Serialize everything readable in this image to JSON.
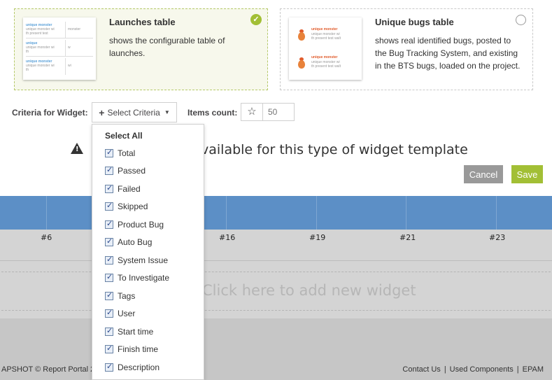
{
  "cards": [
    {
      "title": "Launches table",
      "description": "shows the configurable table of launches.",
      "selected": true,
      "thumb_rows": [
        {
          "line1": "unique monster",
          "line2": "unique monster wi",
          "line3": "th present test",
          "side": "monster"
        },
        {
          "line1": "unique",
          "line2": "unique monster wi",
          "line3": "th",
          "side": "w"
        },
        {
          "line1": "unique monster",
          "line2": "unique monster wi",
          "line3": "th",
          "side": "wi"
        }
      ]
    },
    {
      "title": "Unique bugs table",
      "description": "shows real identified bugs, posted to the Bug Tracking System, and existing in the BTS bugs, loaded on the project.",
      "selected": false,
      "thumb_rows": [
        {
          "line1": "unique monster",
          "line2": "unique monster wi",
          "line3": "th present test walt"
        },
        {
          "line1": "unique monster",
          "line2": "unique monster wi",
          "line3": "th present test walt"
        }
      ]
    }
  ],
  "criteria": {
    "label": "Criteria for Widget:",
    "button_label": "Select Criteria"
  },
  "items_count": {
    "label": "Items count:",
    "placeholder": "50"
  },
  "dropdown": {
    "select_all": "Select All",
    "items": [
      "Total",
      "Passed",
      "Failed",
      "Skipped",
      "Product Bug",
      "Auto Bug",
      "System Issue",
      "To Investigate",
      "Tags",
      "User",
      "Start time",
      "Finish time",
      "Description"
    ]
  },
  "warning_text": "vailable for this type of widget template",
  "buttons": {
    "cancel": "Cancel",
    "save": "Save"
  },
  "background": {
    "x_labels": [
      "#6",
      "#16",
      "#19",
      "#21",
      "#23"
    ],
    "add_widget_text": "Click here to add new widget",
    "footer_left": "APSHOT   © Report Portal  2",
    "footer_links": [
      "Contact Us",
      "Used Components",
      "EPAM"
    ]
  },
  "colors": {
    "accent_green": "#a2bf35",
    "chart_blue": "#5c8fc6",
    "cancel_gray": "#999999"
  }
}
